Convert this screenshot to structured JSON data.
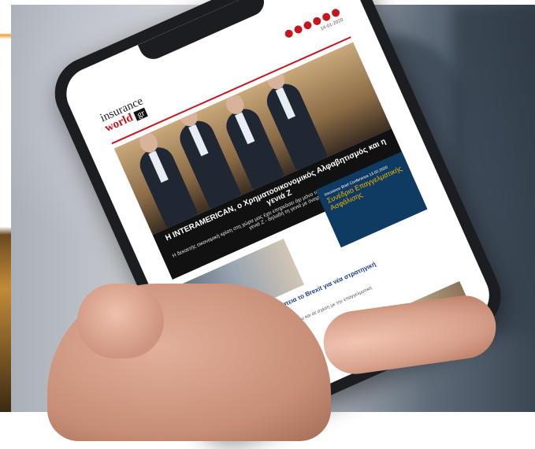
{
  "photo": {
    "subject": "smartphone",
    "colors": {
      "accent": "#c4161c",
      "phone_body": "#1b1d20",
      "ad_bg": "#0f3a62",
      "ad_text": "#f5b400"
    }
  },
  "email": {
    "logo_text_1": "insurance",
    "logo_text_2": "world",
    "logo_text_3": "gr",
    "date": "14-01-2020",
    "headline": "Η INTERAMERICAN, ο Χρηματοοικονομικός Αλφαβητισμός και η γενιά Z",
    "subline": "Η δεκαετής οικονομική κρίση στη χώρα μας έχει επηρεάσει όχι μόνο τον ενήλικο πληθυσμό της, αλλά και τη γενιά Z - δηλαδή τη γενιά με όνειρα",
    "article_title": "Βελλιδής, Brokers Union: Συνέπεια το Brexit για νέα στρατηγική και αύξηση της παρουσίας",
    "article_text": "Με τη δημοσίευση της απόφασης του δικαστηρίου και σε σχέση με την επαγγελματική ασφάλιση...",
    "ad_title": "Συνέδριο Επαγγελματικής Ασφάλισης",
    "ad_sub": "Insurance Brief Conference 13.02.2020"
  }
}
